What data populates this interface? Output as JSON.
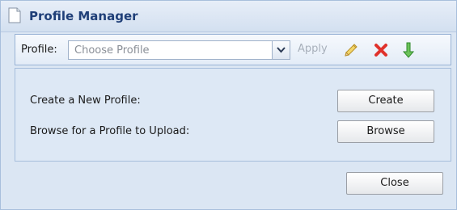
{
  "window": {
    "title": "Profile Manager"
  },
  "toolbar": {
    "profile_label": "Profile:",
    "profile_select": {
      "placeholder": "Choose Profile"
    },
    "apply_label": "Apply",
    "icons": [
      "pencil-icon",
      "delete-icon",
      "download-icon"
    ]
  },
  "panel": {
    "create_label": "Create a New Profile:",
    "create_button": "Create",
    "browse_label": "Browse for a Profile to Upload:",
    "browse_button": "Browse"
  },
  "footer": {
    "close_button": "Close"
  },
  "colors": {
    "title": "#1f3f78",
    "panel_bg": "#dde8f5",
    "delete_red": "#e0322c",
    "download_green": "#3fa637",
    "pencil_yellow": "#e8c24a"
  }
}
